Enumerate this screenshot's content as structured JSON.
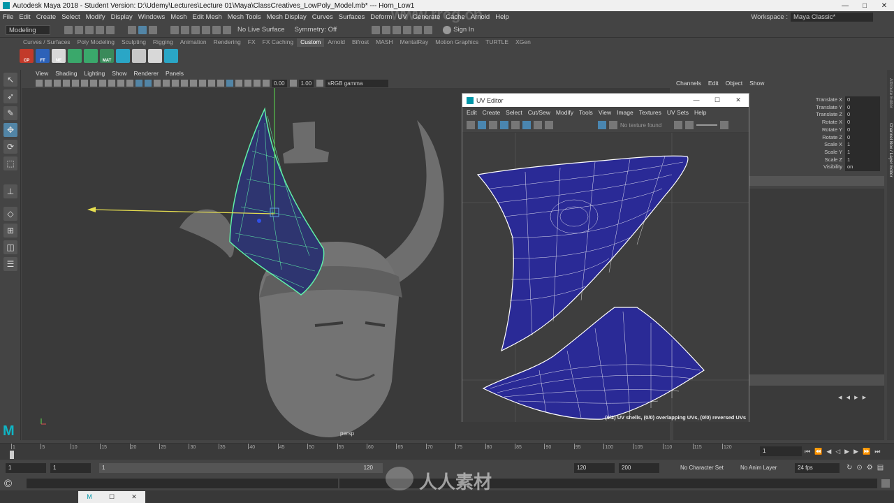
{
  "title": {
    "text": "Autodesk Maya 2018 - Student Version: D:\\Udemy\\Lectures\\Lecture 01\\Maya\\ClassCreatives_LowPoly_Model.mb*   ---   Horn_Low1",
    "controls": [
      "—",
      "□",
      "✕"
    ]
  },
  "menubar": [
    "File",
    "Edit",
    "Create",
    "Select",
    "Modify",
    "Display",
    "Windows",
    "Mesh",
    "Edit Mesh",
    "Mesh Tools",
    "Mesh Display",
    "Curves",
    "Surfaces",
    "Deform",
    "UV",
    "Generate",
    "Cache",
    "Arnold",
    "Help"
  ],
  "workspace": {
    "label": "Workspace :",
    "value": "Maya Classic*"
  },
  "statusline": {
    "mode": "Modeling",
    "live_surface": "No Live Surface",
    "symmetry": "Symmetry: Off",
    "signin": "Sign In"
  },
  "shelf": {
    "tabs": [
      "Curves / Surfaces",
      "Poly Modeling",
      "Sculpting",
      "Rigging",
      "Animation",
      "Rendering",
      "FX",
      "FX Caching",
      "Custom",
      "Arnold",
      "Bifrost",
      "MASH",
      "MentalRay",
      "Motion Graphics",
      "TURTLE",
      "XGen"
    ],
    "active": "Custom",
    "buttons": [
      {
        "label": "CP",
        "color": "#c23a2a"
      },
      {
        "label": "FT",
        "color": "#2d62b8"
      },
      {
        "label": "NE",
        "color": "#d8d8d8"
      },
      {
        "label": "",
        "color": "#3aa86b"
      },
      {
        "label": "",
        "color": "#3aa86b"
      },
      {
        "label": "MAT",
        "color": "#3a8a5a"
      },
      {
        "label": "",
        "color": "#2aa6c6"
      },
      {
        "label": "",
        "color": "#c8c8c8"
      },
      {
        "label": "",
        "color": "#d8d8d8"
      },
      {
        "label": "",
        "color": "#2aa6c6"
      }
    ]
  },
  "viewport": {
    "menu": [
      "View",
      "Shading",
      "Lighting",
      "Show",
      "Renderer",
      "Panels"
    ],
    "field1": "0.00",
    "field2": "1.00",
    "colorspace": "sRGB gamma",
    "camera": "persp"
  },
  "uv_editor": {
    "title": "UV Editor",
    "controls": [
      "—",
      "☐",
      "✕"
    ],
    "menu": [
      "Edit",
      "Create",
      "Select",
      "Cut/Sew",
      "Modify",
      "Tools",
      "View",
      "Image",
      "Textures",
      "UV Sets",
      "Help"
    ],
    "texture_status": "No texture found",
    "status": "(0/2) UV shells, (0/0) overlapping UVs, (0/0) reversed UVs"
  },
  "channel_box": {
    "tabs": [
      "Channels",
      "Edit",
      "Object",
      "Show"
    ],
    "attributes": [
      {
        "name": "Translate X",
        "value": "0"
      },
      {
        "name": "Translate Y",
        "value": "0"
      },
      {
        "name": "Translate Z",
        "value": "0"
      },
      {
        "name": "Rotate X",
        "value": "0"
      },
      {
        "name": "Rotate Y",
        "value": "0"
      },
      {
        "name": "Rotate Z",
        "value": "0"
      },
      {
        "name": "Scale X",
        "value": "1"
      },
      {
        "name": "Scale Y",
        "value": "1"
      },
      {
        "name": "Scale Z",
        "value": "1"
      },
      {
        "name": "Visibility",
        "value": "on"
      }
    ],
    "side_label_1": "Attribute Editor",
    "side_label_2": "Channel Box / Layer Editor"
  },
  "timeline": {
    "ticks": [
      "1",
      "5",
      "10",
      "15",
      "20",
      "25",
      "30",
      "35",
      "40",
      "45",
      "50",
      "55",
      "60",
      "65",
      "70",
      "75",
      "80",
      "85",
      "90",
      "95",
      "100",
      "105",
      "110",
      "115",
      "120"
    ],
    "current_frame": "1"
  },
  "range": {
    "start": "1",
    "start2": "1",
    "slider_start": "1",
    "slider_end": "120",
    "end": "120",
    "end2": "200",
    "character_set": "No Character Set",
    "anim_layer": "No Anim Layer",
    "fps": "24 fps"
  },
  "watermark": {
    "domain": "www.rrcg.cn",
    "logo_text": "人人素材"
  }
}
